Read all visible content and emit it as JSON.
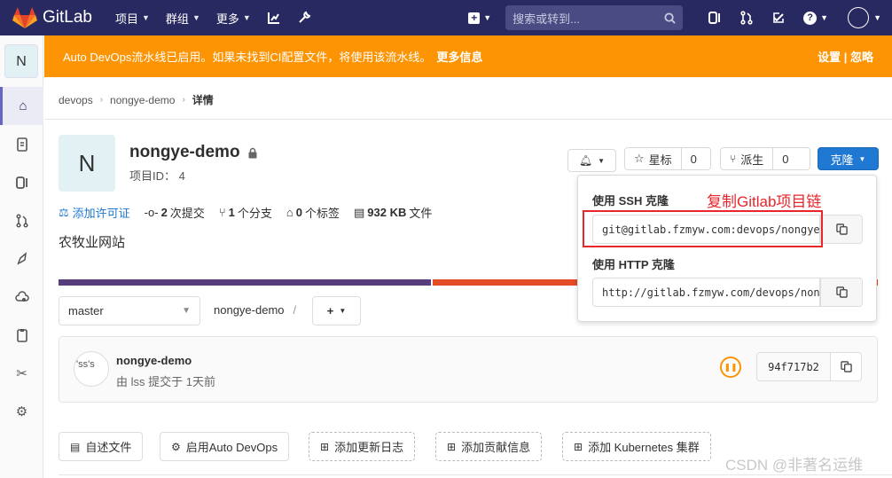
{
  "nav": {
    "brand": "GitLab",
    "menu": [
      {
        "label": "项目"
      },
      {
        "label": "群组"
      },
      {
        "label": "更多"
      }
    ],
    "search_placeholder": "搜索或转到..."
  },
  "sidebar": {
    "project_initial": "N"
  },
  "banner": {
    "text": "Auto DevOps流水线已启用。如果未找到CI配置文件，将使用该流水线。",
    "more_link": "更多信息",
    "settings_link": "设置 | 忽略"
  },
  "breadcrumb": {
    "items": [
      "devops",
      "nongye-demo"
    ],
    "current": "详情"
  },
  "project": {
    "initial": "N",
    "name": "nongye-demo",
    "id_text": "项目ID： 4",
    "description": "农牧业网站"
  },
  "actions": {
    "star_label": "星标",
    "star_count": "0",
    "fork_label": "派生",
    "fork_count": "0",
    "clone_label": "克隆"
  },
  "stats": {
    "license": "添加许可证",
    "commits_count": "2",
    "commits_label": "次提交",
    "branches_count": "1",
    "branches_label": "个分支",
    "tags_count": "0",
    "tags_label": "个标签",
    "size": "932 KB",
    "size_label": "文件"
  },
  "language_bar": [
    {
      "color": "#563d7c",
      "fraction": 0.455
    },
    {
      "color": "#e34c26",
      "fraction": 0.545
    }
  ],
  "repo": {
    "branch": "master",
    "path": "nongye-demo",
    "path_sep": "/"
  },
  "commit": {
    "avatar_alt": "'ss's",
    "title": "nongye-demo",
    "meta": "由 lss 提交于 1天前",
    "sha": "94f717b2"
  },
  "quick_actions": {
    "readme": "自述文件",
    "autodevops": "启用Auto DevOps",
    "changelog": "添加更新日志",
    "contributing": "添加贡献信息",
    "kubernetes": "添加 Kubernetes 集群"
  },
  "clone_popup": {
    "ssh_title": "使用 SSH 克隆",
    "ssh_url": "git@gitlab.fzmyw.com:devops/nongye-demo.git",
    "http_title": "使用 HTTP 克隆",
    "http_url": "http://gitlab.fzmyw.com/devops/nongye-demo.git",
    "annotation": "复制Gitlab项目链"
  },
  "watermark": "CSDN @非著名运维"
}
